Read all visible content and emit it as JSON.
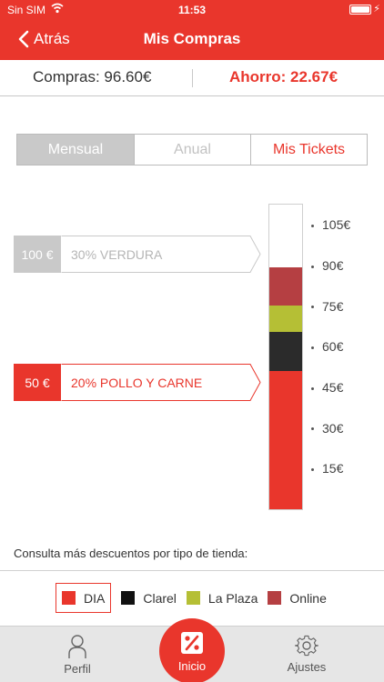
{
  "status_bar": {
    "carrier": "Sin SIM",
    "time": "11:53"
  },
  "nav": {
    "back_label": "Atrás",
    "title": "Mis Compras"
  },
  "summary": {
    "compras": "Compras: 96.60€",
    "ahorro": "Ahorro: 22.67€"
  },
  "tabs": [
    {
      "label": "Mensual",
      "selected": true
    },
    {
      "label": "Anual",
      "selected": false
    },
    {
      "label": "Mis Tickets",
      "selected": false
    }
  ],
  "discount_tags": [
    {
      "amount": "100 €",
      "text": "30% VERDURA",
      "style": "inactive"
    },
    {
      "amount": "50 €",
      "text": "20% POLLO Y CARNE",
      "style": "active"
    }
  ],
  "chart_data": {
    "type": "bar",
    "stacked": true,
    "ylim": [
      0,
      112.5
    ],
    "yticks": [
      "15€",
      "30€",
      "45€",
      "60€",
      "75€",
      "90€",
      "105€"
    ],
    "ytick_values": [
      15,
      30,
      45,
      60,
      75,
      90,
      105
    ],
    "series": [
      {
        "name": "DIA",
        "value": 51.2,
        "color": "#e9362c"
      },
      {
        "name": "Clarel",
        "value": 14.3,
        "color": "#2b2b2b"
      },
      {
        "name": "La Plaza",
        "value": 9.8,
        "color": "#b5bf35"
      },
      {
        "name": "Online",
        "value": 14.2,
        "color": "#b53f42"
      }
    ]
  },
  "footer": {
    "consulta": "Consulta más descuentos por tipo de tienda:"
  },
  "legend": [
    {
      "label": "DIA",
      "color": "#e9362c",
      "selected": true
    },
    {
      "label": "Clarel",
      "color": "#111111",
      "selected": false
    },
    {
      "label": "La Plaza",
      "color": "#b5bf35",
      "selected": false
    },
    {
      "label": "Online",
      "color": "#b53f42",
      "selected": false
    }
  ],
  "tabbar": {
    "perfil": "Perfil",
    "inicio": "Inicio",
    "ajustes": "Ajustes"
  },
  "colors": {
    "brand_red": "#e9362c",
    "inactive_grey": "#c9c9c9"
  }
}
